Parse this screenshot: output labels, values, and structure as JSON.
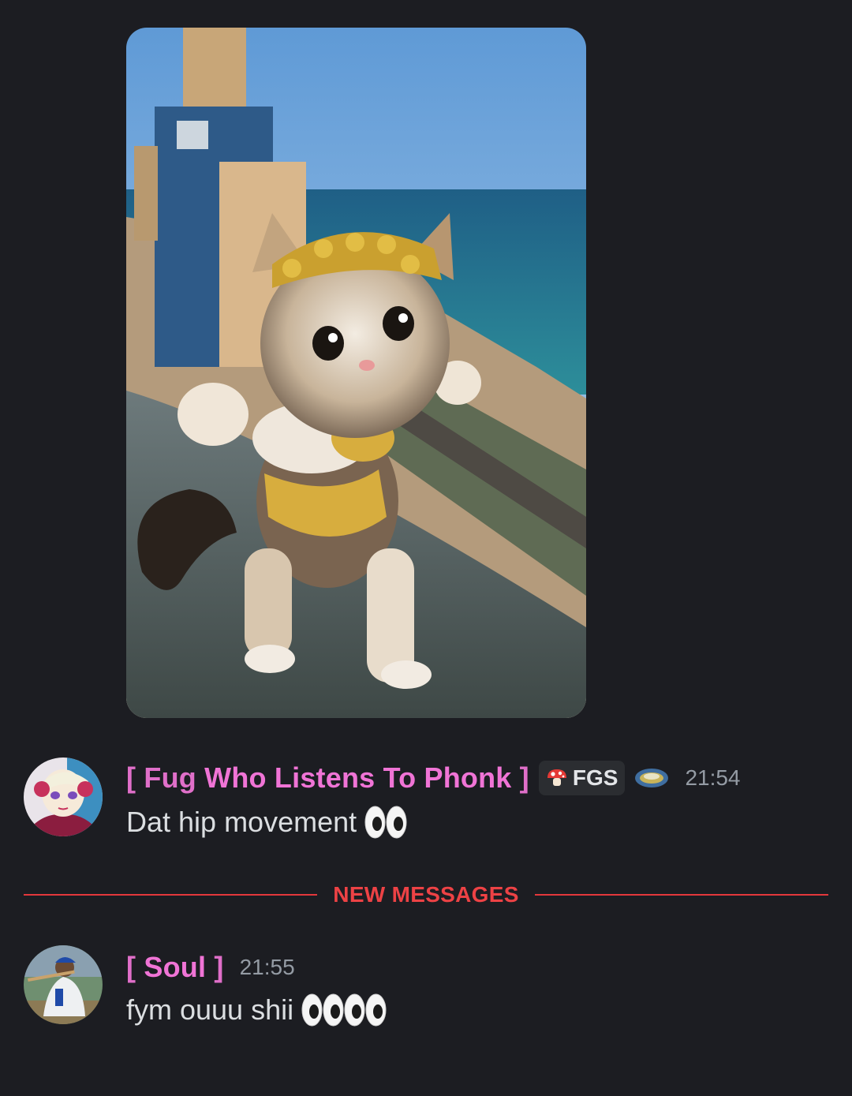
{
  "attachment": {
    "kind": "video-thumbnail",
    "icon": "kitten-dancing-image"
  },
  "messages": [
    {
      "avatar_icon": "anime-avatar",
      "username_open": "[ Fug ",
      "username_mid": "Who Listens To Phonk",
      "username_close": " ]",
      "tag": "FGS",
      "tag_icon": "mushroom-icon",
      "badge_icon": "guild-badge-icon",
      "timestamp": "21:54",
      "text": "Dat hip movement",
      "emoji": [
        "eyes-emoji"
      ]
    },
    {
      "avatar_icon": "baseball-player-avatar",
      "username_open": "[ ",
      "username_mid": "Soul",
      "username_close": " ]",
      "timestamp": "21:55",
      "text": "fym ouuu shii",
      "emoji": [
        "eyes-emoji",
        "eyes-emoji"
      ]
    }
  ],
  "divider": {
    "label": "NEW MESSAGES",
    "color": "#ed4245"
  },
  "colors": {
    "background": "#1c1d22",
    "username_pink": "#f074d6",
    "username_violet": "#c98ef2",
    "timestamp": "#949ba4"
  }
}
